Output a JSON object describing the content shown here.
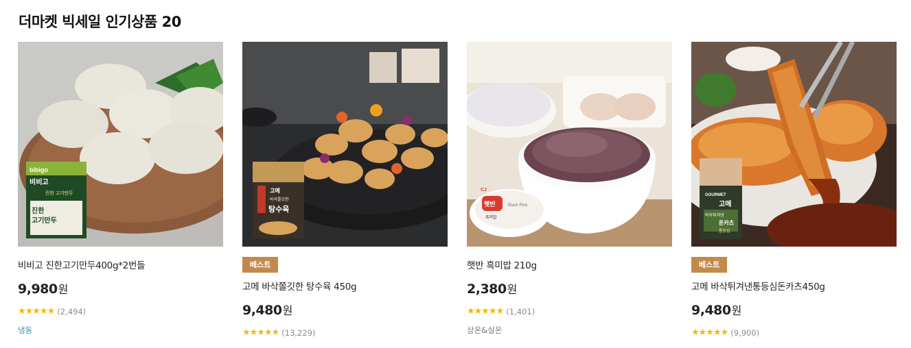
{
  "section": {
    "title": "더마켓 빅세일 인기상품 20"
  },
  "products": [
    {
      "image_alt": "비비고 진한고기만두",
      "package_text": [
        "bibigo",
        "비비고",
        "진한 고기만두",
        "진한",
        "고기만두"
      ],
      "badge": "",
      "name": "비비고 진한고기만두400g*2번들",
      "price": "9,980",
      "currency": "원",
      "stars": "★★★★★",
      "rating": 5,
      "reviews": "(2,494)",
      "storage": "냉동"
    },
    {
      "image_alt": "고메 바삭쫄깃한 탕수육",
      "package_text": [
        "고메",
        "바삭쫄깃한",
        "탕수육"
      ],
      "badge": "베스트",
      "name": "고메 바삭쫄깃한 탕수육 450g",
      "price": "9,480",
      "currency": "원",
      "stars": "★★★★★",
      "rating": 5,
      "reviews": "(13,229)",
      "storage": ""
    },
    {
      "image_alt": "햇반 흑미밥",
      "package_text": [
        "CJ",
        "햇반",
        "흑미밥",
        "Black Rice"
      ],
      "badge": "",
      "name": "햇반 흑미밥 210g",
      "price": "2,380",
      "currency": "원",
      "stars": "★★★★★",
      "rating": 5,
      "reviews": "(1,401)",
      "storage": "상온&실온"
    },
    {
      "image_alt": "고메 바삭튀겨낸통등심돈카츠",
      "package_text": [
        "GOURMET",
        "고메",
        "바삭튀겨낸",
        "돈카츠",
        "통등심"
      ],
      "badge": "베스트",
      "name": "고메 바삭튀겨낸통등심돈카츠450g",
      "price": "9,480",
      "currency": "원",
      "stars": "★★★★★",
      "rating": 5,
      "reviews": "(9,900)",
      "storage": ""
    }
  ]
}
